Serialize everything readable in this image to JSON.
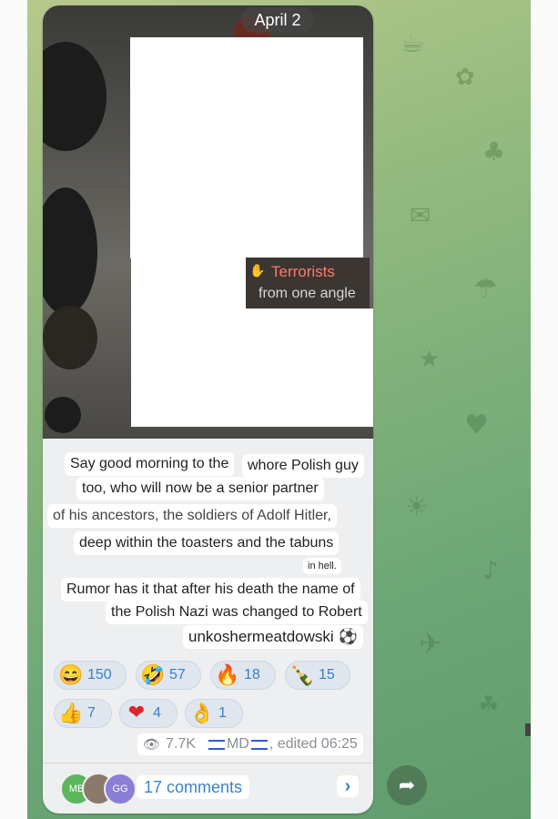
{
  "date_label": "April 2",
  "sticker": {
    "title": "Terrorists",
    "subtitle": "from one angle"
  },
  "message_lines": [
    "Say good morning to the",
    "whore Polish guy",
    "too, who will now be a senior partner",
    "of his ancestors, the soldiers of Adolf Hitler,",
    "deep within the toasters and the tabuns",
    "in hell.",
    "Rumor has it that after his death the name of",
    "the Polish Nazi was changed to Robert",
    "unkoshermeatdowski"
  ],
  "ball_emoji": "⚽",
  "reactions": [
    {
      "emoji": "😄",
      "icon": "grinning-face-icon",
      "count": "150"
    },
    {
      "emoji": "🤣",
      "icon": "rolling-laughing-icon",
      "count": "57"
    },
    {
      "emoji": "🔥",
      "icon": "fire-icon",
      "count": "18"
    },
    {
      "emoji": "🍾",
      "icon": "champagne-icon",
      "count": "15"
    },
    {
      "emoji": "👍",
      "icon": "thumbs-up-icon",
      "count": "7"
    },
    {
      "emoji": "❤",
      "icon": "heart-icon",
      "count": "4"
    },
    {
      "emoji": "👌",
      "icon": "ok-hand-icon",
      "count": "1"
    }
  ],
  "meta": {
    "views": "7.7K",
    "author": "MD",
    "edited": ", edited 06:25"
  },
  "comments": {
    "avatars": [
      {
        "initials": "MB",
        "color": "#5bb65e"
      },
      {
        "initials": "",
        "color": "#8a7a6c"
      },
      {
        "initials": "GG",
        "color": "#8a7ed6"
      }
    ],
    "label": "17 comments"
  },
  "colors": {
    "accent": "#3b82cc",
    "bubble": "#eeeff0",
    "reaction_bg": "#dfe6ee"
  }
}
